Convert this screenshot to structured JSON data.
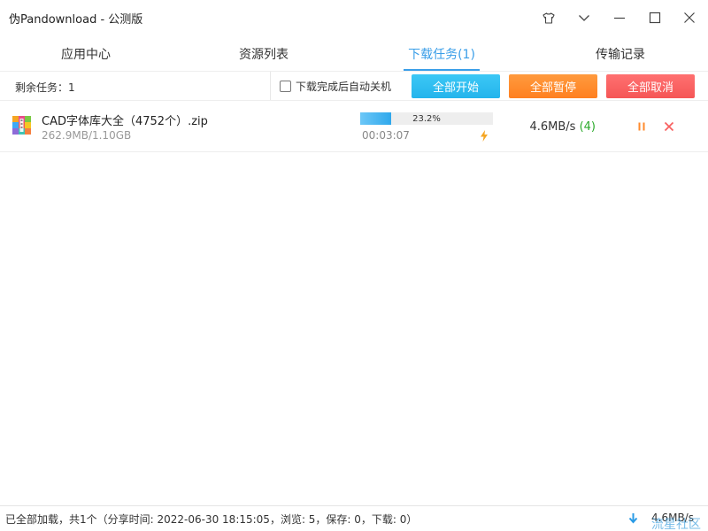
{
  "window": {
    "title": "伪Pandownload - 公测版",
    "controls": [
      "skin-icon",
      "collapse-icon",
      "minimize-icon",
      "maximize-icon",
      "close-icon"
    ]
  },
  "tabs": [
    {
      "label": "应用中心",
      "active": false
    },
    {
      "label": "资源列表",
      "active": false
    },
    {
      "label": "下载任务(1)",
      "active": true
    },
    {
      "label": "传输记录",
      "active": false
    }
  ],
  "toolbar": {
    "remaining_label": "剩余任务：1",
    "auto_shutdown_label": "下载完成后自动关机",
    "auto_shutdown_checked": false,
    "start_all": "全部开始",
    "pause_all": "全部暂停",
    "cancel_all": "全部取消"
  },
  "tasks": [
    {
      "icon": "archive-file-icon",
      "filename": "CAD字体库大全（4752个）.zip",
      "size": "262.9MB/1.10GB",
      "progress": 0.232,
      "progress_text": "23.2%",
      "elapsed": "00:03:07",
      "speed": "4.6MB/s",
      "connections": "(4)"
    }
  ],
  "status": {
    "text": "已全部加载，共1个（分享时间: 2022-06-30 18:15:05，浏览: 5，保存: 0，下载: 0）",
    "total_speed": "4.6MB/s"
  },
  "watermark": "流星社区",
  "colors": {
    "accent": "#3a9ee8",
    "start": "#2ab6ee",
    "pause": "#ff8a2c",
    "cancel": "#f75f5f",
    "connections": "#2aaa2a"
  }
}
